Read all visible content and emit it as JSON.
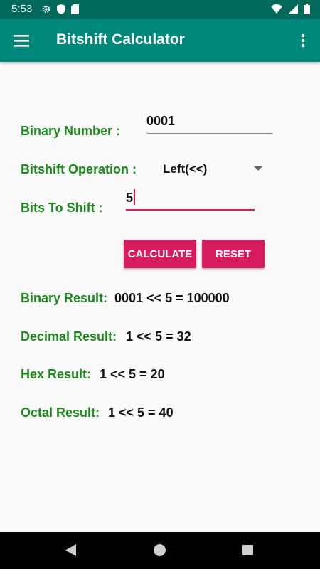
{
  "status_bar": {
    "time": "5:53"
  },
  "app_bar": {
    "title": "Bitshift Calculator"
  },
  "form": {
    "binary_label": "Binary Number  :",
    "binary_value": "0001",
    "operation_label": "Bitshift Operation :",
    "operation_value": "Left(<<)",
    "bits_label": "Bits To Shift :",
    "bits_value": "5"
  },
  "buttons": {
    "calculate": "CALCULATE",
    "reset": "RESET"
  },
  "results": {
    "binary_label": "Binary Result:",
    "binary_value": "0001 << 5 = 100000",
    "decimal_label": "Decimal Result:",
    "decimal_value": "1 << 5 = 32",
    "hex_label": "Hex Result:",
    "hex_value": "1 << 5 = 20",
    "octal_label": "Octal Result:",
    "octal_value": "1 << 5 = 40"
  },
  "colors": {
    "app_bar": "#00897b",
    "status_bar": "#00695c",
    "accent": "#d81b60",
    "label_green": "#1b8a1b"
  }
}
